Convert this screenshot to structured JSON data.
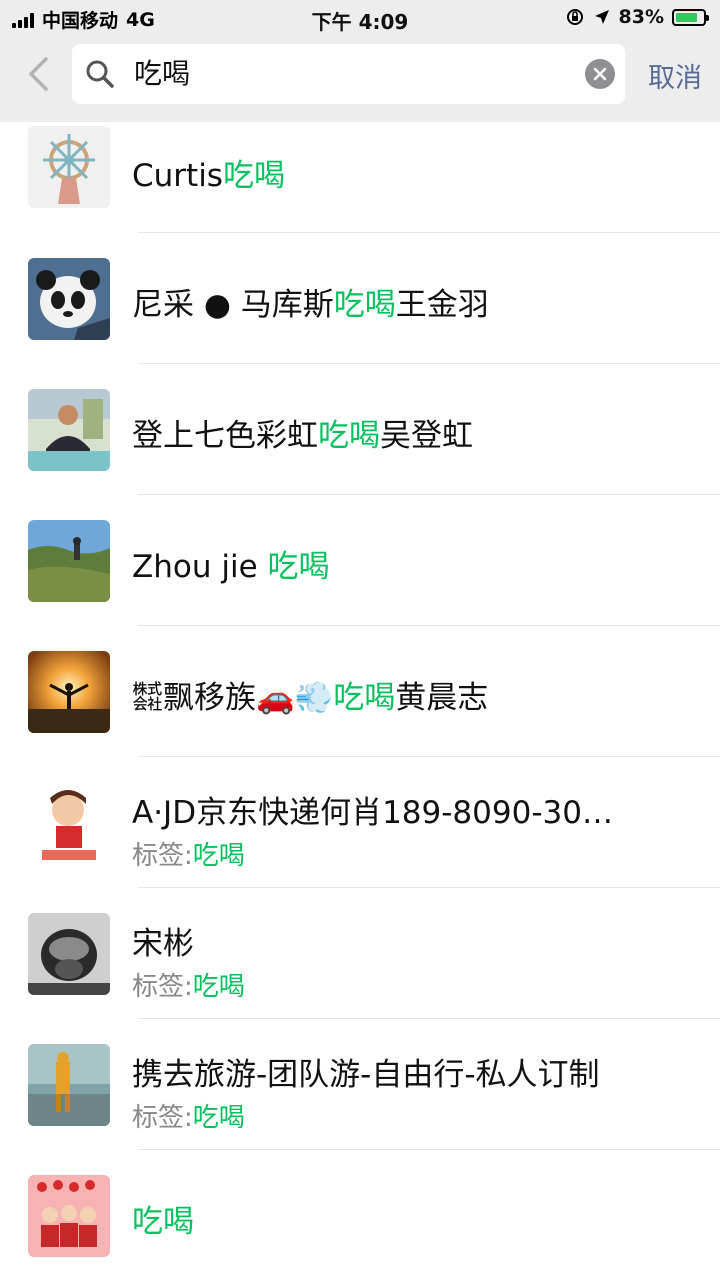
{
  "status_bar": {
    "carrier": "中国移动",
    "network": "4G",
    "time": "下午 4:09",
    "battery": "83%"
  },
  "search": {
    "query": "吃喝",
    "cancel_label": "取消"
  },
  "results": [
    {
      "name_before": "Curtis",
      "name_match": "吃喝",
      "name_after": ""
    },
    {
      "name_before": "尼采 ● 马库斯",
      "name_match": "吃喝",
      "name_after": "王金羽"
    },
    {
      "name_before": "登上七色彩虹",
      "name_match": "吃喝",
      "name_after": "吴登虹"
    },
    {
      "name_before": "Zhou jie ",
      "name_match": "吃喝",
      "name_after": ""
    },
    {
      "name_before": "㍿飘移族🚗💨",
      "name_match": "吃喝",
      "name_after": "黄晨志"
    },
    {
      "name": "A·JD京东快递何肖189-8090-30…",
      "tag_prefix": "标签:",
      "tag_match": "吃喝"
    },
    {
      "name": "宋彬",
      "tag_prefix": "标签:",
      "tag_match": "吃喝"
    },
    {
      "name": "携去旅游-团队游-自由行-私人订制",
      "tag_prefix": "标签:",
      "tag_match": "吃喝"
    },
    {
      "name_before": "",
      "name_match": "吃喝",
      "name_after": ""
    }
  ],
  "colors": {
    "highlight": "#07c160",
    "cancel": "#576b95",
    "header_bg": "#ededed"
  }
}
